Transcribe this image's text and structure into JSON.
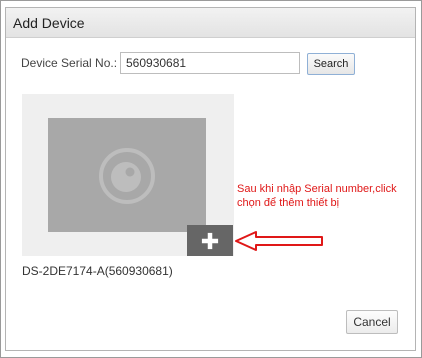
{
  "dialog": {
    "title": "Add Device"
  },
  "serial": {
    "label": "Device Serial No.:",
    "value": "560930681"
  },
  "search_button": {
    "label": "Search"
  },
  "device": {
    "name": "DS-2DE7174-A(560930681)",
    "thumbnail_icon": "camera-icon",
    "add_icon": "plus-icon"
  },
  "annotation": {
    "text": "Sau khi nhập Serial number,click chọn để thêm thiết bị",
    "color": "#e01818"
  },
  "cancel_button": {
    "label": "Cancel"
  },
  "colors": {
    "add_button": "#666666",
    "thumbnail": "#a8a8a8",
    "card": "#efefef",
    "search_border": "#8fb0d6"
  }
}
